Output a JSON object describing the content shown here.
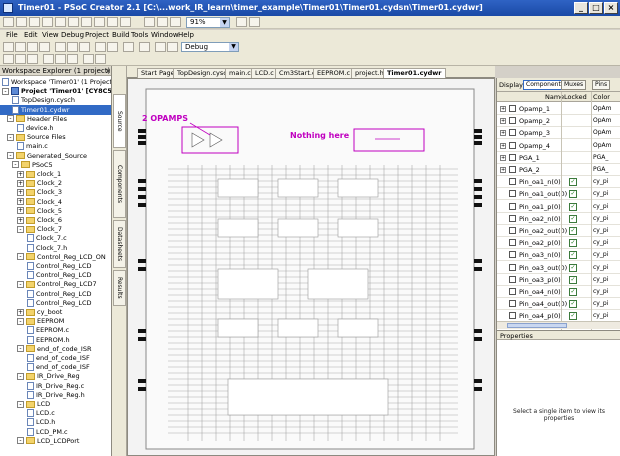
{
  "window": {
    "title": "Timer01 - PSoC Creator 2.1  [C:\\...work_IR_learn\\timer_example\\Timer01\\Timer01.cydsn\\Timer01.cydwr]",
    "min": "_",
    "max": "□",
    "close": "×"
  },
  "toolbar": {
    "zoom_value": "91%",
    "config_value": "Debug"
  },
  "menu": [
    "File",
    "Edit",
    "View",
    "Debug",
    "Project",
    "Build",
    "Tools",
    "Window",
    "Help"
  ],
  "workspace": {
    "panel_title": "Workspace Explorer (1 project)",
    "close": "x",
    "tree": [
      {
        "indent": 0,
        "kind": "file",
        "label": "Workspace 'Timer01' (1 Projects)"
      },
      {
        "indent": 0,
        "kind": "proj",
        "label": "Project 'Timer01' [CY8C5068",
        "bold": true,
        "pm": "-"
      },
      {
        "indent": 2,
        "kind": "file",
        "label": "TopDesign.cysch"
      },
      {
        "indent": 2,
        "kind": "file",
        "label": "Timer01.cydwr",
        "selected": true
      },
      {
        "indent": 1,
        "kind": "folder",
        "label": "Header Files",
        "pm": "-"
      },
      {
        "indent": 3,
        "kind": "file",
        "label": "device.h"
      },
      {
        "indent": 1,
        "kind": "folder",
        "label": "Source Files",
        "pm": "-"
      },
      {
        "indent": 3,
        "kind": "file",
        "label": "main.c"
      },
      {
        "indent": 1,
        "kind": "folder",
        "label": "Generated_Source",
        "pm": "-"
      },
      {
        "indent": 2,
        "kind": "folder",
        "label": "PSoC5",
        "pm": "-"
      },
      {
        "indent": 3,
        "kind": "folder",
        "label": "clock_1",
        "pm": "+"
      },
      {
        "indent": 3,
        "kind": "folder",
        "label": "Clock_2",
        "pm": "+"
      },
      {
        "indent": 3,
        "kind": "folder",
        "label": "Clock_3",
        "pm": "+"
      },
      {
        "indent": 3,
        "kind": "folder",
        "label": "Clock_4",
        "pm": "+"
      },
      {
        "indent": 3,
        "kind": "folder",
        "label": "Clock_5",
        "pm": "+"
      },
      {
        "indent": 3,
        "kind": "folder",
        "label": "Clock_6",
        "pm": "+"
      },
      {
        "indent": 3,
        "kind": "folder",
        "label": "Clock_7",
        "pm": "-"
      },
      {
        "indent": 5,
        "kind": "file",
        "label": "Clock_7.c"
      },
      {
        "indent": 5,
        "kind": "file",
        "label": "Clock_7.h"
      },
      {
        "indent": 3,
        "kind": "folder",
        "label": "Control_Reg_LCD_ON",
        "pm": "-"
      },
      {
        "indent": 5,
        "kind": "file",
        "label": "Control_Reg_LCD"
      },
      {
        "indent": 5,
        "kind": "file",
        "label": "Control_Reg_LCD"
      },
      {
        "indent": 3,
        "kind": "folder",
        "label": "Control_Reg_LCD7",
        "pm": "-"
      },
      {
        "indent": 5,
        "kind": "file",
        "label": "Control_Reg_LCD"
      },
      {
        "indent": 5,
        "kind": "file",
        "label": "Control_Reg_LCD"
      },
      {
        "indent": 3,
        "kind": "folder",
        "label": "cy_boot",
        "pm": "+"
      },
      {
        "indent": 3,
        "kind": "folder",
        "label": "EEPROM",
        "pm": "-"
      },
      {
        "indent": 5,
        "kind": "file",
        "label": "EEPROM.c"
      },
      {
        "indent": 5,
        "kind": "file",
        "label": "EEPROM.h"
      },
      {
        "indent": 3,
        "kind": "folder",
        "label": "end_of_code_ISR",
        "pm": "-"
      },
      {
        "indent": 5,
        "kind": "file",
        "label": "end_of_code_ISF"
      },
      {
        "indent": 5,
        "kind": "file",
        "label": "end_of_code_ISF"
      },
      {
        "indent": 3,
        "kind": "folder",
        "label": "IR_Drive_Reg",
        "pm": "-"
      },
      {
        "indent": 5,
        "kind": "file",
        "label": "IR_Drive_Reg.c"
      },
      {
        "indent": 5,
        "kind": "file",
        "label": "IR_Drive_Reg.h"
      },
      {
        "indent": 3,
        "kind": "folder",
        "label": "LCD",
        "pm": "-"
      },
      {
        "indent": 5,
        "kind": "file",
        "label": "LCD.c"
      },
      {
        "indent": 5,
        "kind": "file",
        "label": "LCD.h"
      },
      {
        "indent": 5,
        "kind": "file",
        "label": "LCD_PM.c"
      },
      {
        "indent": 3,
        "kind": "folder",
        "label": "LCD_LCDPort",
        "pm": "-"
      }
    ]
  },
  "side_tabs": [
    "Source",
    "Components",
    "Datasheets",
    "Results"
  ],
  "doc_tabs": [
    "Start Page",
    "TopDesign.cysch",
    "main.c",
    "LCD.c",
    "Cm3Start.c",
    "EEPROM.c",
    "project.h",
    "Timer01.cydwr"
  ],
  "active_doc_tab": "Timer01.cydwr",
  "canvas": {
    "annotation_1": "2 OPAMPS",
    "annotation_2": "Nothing here",
    "annotation_color": "#c000c0"
  },
  "right_panel": {
    "display_label": "Display:",
    "buttons": [
      "Components",
      "Muxes",
      "Pins"
    ],
    "columns": [
      "Name",
      "Locked",
      "Color"
    ],
    "rows": [
      {
        "pm": "+",
        "name": "Opamp_1",
        "locked": false,
        "extra": "OpAm"
      },
      {
        "pm": "+",
        "name": "Opamp_2",
        "locked": false,
        "extra": "OpAm"
      },
      {
        "pm": "+",
        "name": "Opamp_3",
        "locked": false,
        "extra": "OpAm"
      },
      {
        "pm": "+",
        "name": "Opamp_4",
        "locked": false,
        "extra": "OpAm"
      },
      {
        "pm": "+",
        "name": "PGA_1",
        "locked": false,
        "extra": "PGA_"
      },
      {
        "pm": "+",
        "name": "PGA_2",
        "locked": false,
        "extra": "PGA_"
      },
      {
        "pm": "",
        "name": "Pin_oa1_n(0)",
        "locked": true,
        "extra": "cy_pi"
      },
      {
        "pm": "",
        "name": "Pin_oa1_out(0)",
        "locked": true,
        "extra": "cy_pi"
      },
      {
        "pm": "",
        "name": "Pin_oa1_p(0)",
        "locked": true,
        "extra": "cy_pi"
      },
      {
        "pm": "",
        "name": "Pin_oa2_n(0)",
        "locked": true,
        "extra": "cy_pi"
      },
      {
        "pm": "",
        "name": "Pin_oa2_out(0)",
        "locked": true,
        "extra": "cy_pi"
      },
      {
        "pm": "",
        "name": "Pin_oa2_p(0)",
        "locked": true,
        "extra": "cy_pi"
      },
      {
        "pm": "",
        "name": "Pin_oa3_n(0)",
        "locked": true,
        "extra": "cy_pi"
      },
      {
        "pm": "",
        "name": "Pin_oa3_out(0)",
        "locked": true,
        "extra": "cy_pi"
      },
      {
        "pm": "",
        "name": "Pin_oa3_p(0)",
        "locked": true,
        "extra": "cy_pi"
      },
      {
        "pm": "",
        "name": "Pin_oa4_n(0)",
        "locked": true,
        "extra": "cy_pi"
      },
      {
        "pm": "",
        "name": "Pin_oa4_out(0)",
        "locked": true,
        "extra": "cy_pi"
      },
      {
        "pm": "",
        "name": "Pin_oa4_p(0)",
        "locked": true,
        "extra": "cy_pi"
      }
    ],
    "properties_title": "Properties",
    "properties_message": "Select a single item to view its properties"
  }
}
